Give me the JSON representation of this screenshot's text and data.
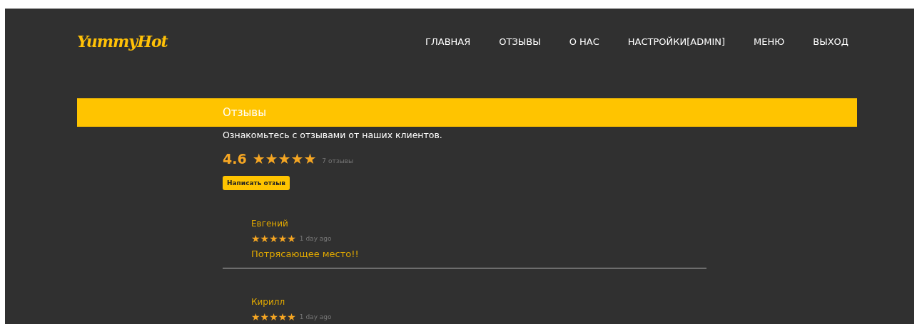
{
  "logo": "YummyHot",
  "nav": [
    {
      "label": "ГЛАВНАЯ"
    },
    {
      "label": "ОТЗЫВЫ"
    },
    {
      "label": "О НАС"
    },
    {
      "label": "НАСТРОЙКИ[ADMIN]"
    },
    {
      "label": "МЕНЮ"
    },
    {
      "label": "ВЫХОД"
    }
  ],
  "banner": {
    "title": "Отзывы"
  },
  "intro": "Ознакомьтесь с отзывами от наших клиентов.",
  "summary": {
    "rating": "4.6",
    "stars": 5,
    "count": "7 отзывы"
  },
  "write_button": "Написать отзыв",
  "reviews": [
    {
      "name": "Евгений",
      "stars": 5,
      "time": "1 day ago",
      "text": "Потрясающее место!!"
    },
    {
      "name": "Кирилл",
      "stars": 5,
      "time": "1 day ago"
    }
  ]
}
